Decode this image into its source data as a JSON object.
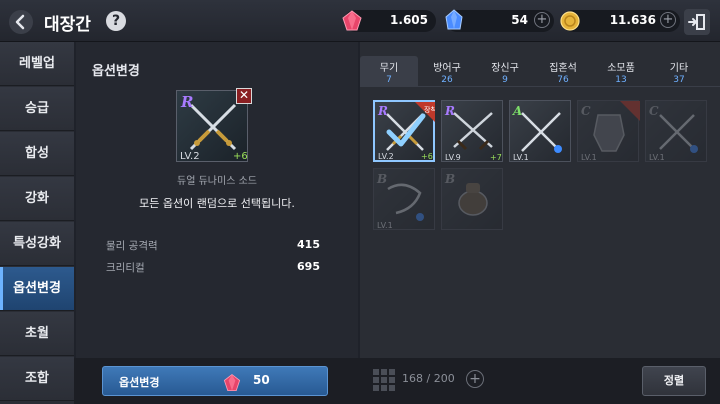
{
  "header": {
    "title": "대장간",
    "help_icon": "?",
    "currencies": [
      {
        "icon": "red-gem-icon",
        "amount": "1.605",
        "color": "#e8456a"
      },
      {
        "icon": "blue-crystal-icon",
        "amount": "54",
        "color": "#4a8cff",
        "plus": "+"
      },
      {
        "icon": "gold-coin-icon",
        "amount": "11.636",
        "color": "#e6b43a",
        "plus": "+"
      }
    ]
  },
  "sidebar": {
    "items": [
      {
        "label": "레벨업"
      },
      {
        "label": "승급"
      },
      {
        "label": "합성"
      },
      {
        "label": "강화"
      },
      {
        "label": "특성강화"
      },
      {
        "label": "옵션변경",
        "active": true
      },
      {
        "label": "초월"
      },
      {
        "label": "조합"
      }
    ]
  },
  "left_panel": {
    "title": "옵션변경",
    "item": {
      "grade": "R",
      "level": "LV.2",
      "enhance": "+6",
      "name": "듀얼 듀나미스 소드",
      "remove_icon": "✕"
    },
    "description": "모든 옵션이 랜덤으로 선택됩니다.",
    "stats": [
      {
        "label": "물리 공격력",
        "value": "415"
      },
      {
        "label": "크리티컬",
        "value": "695"
      }
    ]
  },
  "tabs": [
    {
      "label": "무기",
      "count": "7",
      "active": true
    },
    {
      "label": "방어구",
      "count": "26"
    },
    {
      "label": "장신구",
      "count": "9"
    },
    {
      "label": "집혼석",
      "count": "76"
    },
    {
      "label": "소모품",
      "count": "13"
    },
    {
      "label": "기타",
      "count": "37"
    }
  ],
  "inventory": [
    {
      "grade": "R",
      "level": "LV.2",
      "enhance": "+6",
      "selected": true,
      "badge": "장착"
    },
    {
      "grade": "R",
      "level": "LV.9",
      "enhance": "+7"
    },
    {
      "grade": "A",
      "level": "LV.1",
      "enhance": ""
    },
    {
      "grade": "C",
      "level": "LV.1",
      "enhance": "",
      "dim": true
    },
    {
      "grade": "C",
      "level": "LV.1",
      "enhance": "",
      "dim": true
    },
    {
      "grade": "B",
      "level": "LV.1",
      "enhance": "",
      "dim": true
    },
    {
      "grade": "B",
      "level": "",
      "enhance": "",
      "dim": true
    }
  ],
  "bottom": {
    "change_label": "옵션변경",
    "cost": "50",
    "inventory_count": "168 / 200",
    "inventory_plus": "+",
    "sort_label": "정렬"
  }
}
